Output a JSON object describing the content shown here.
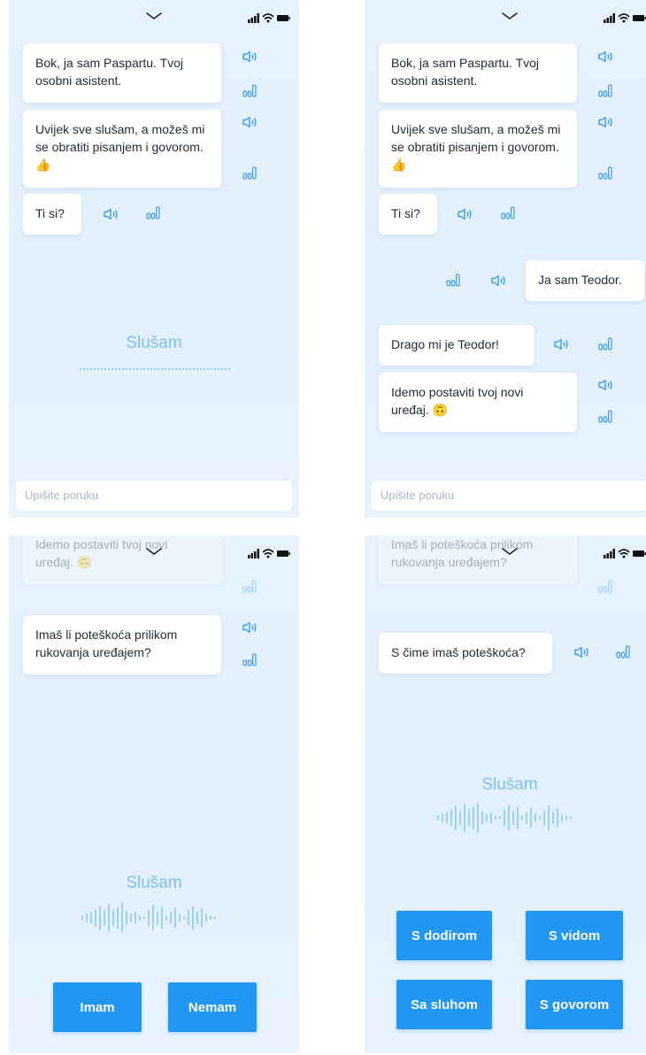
{
  "screen1": {
    "messages": [
      "Bok, ja sam Paspartu. Tvoj osobni asistent.",
      "Uvijek sve slušam, a možeš mi se obratiti pisanjem i govorom.",
      "Ti si?"
    ],
    "listening_label": "Slušam",
    "input_placeholder": "Upišite poruku"
  },
  "screen2": {
    "messages": [
      "Bok, ja sam Paspartu. Tvoj osobni asistent.",
      "Uvijek sve slušam, a možeš mi se obratiti pisanjem i govorom.",
      "Ti si?",
      "Ja sam Teodor.",
      "Drago mi je Teodor!",
      "Idemo postaviti tvoj novi uređaj."
    ],
    "input_placeholder": "Upišite poruku"
  },
  "screen3": {
    "messages": [
      "Idemo postaviti tvoj novi uređaj.",
      "Imaš li poteškoća prilikom rukovanja uređajem?"
    ],
    "listening_label": "Slušam",
    "buttons": [
      "Imam",
      "Nemam"
    ]
  },
  "screen4": {
    "messages": [
      "Imaš li poteškoća prilikom rukovanja uređajem?",
      "S čime imaš poteškoća?"
    ],
    "listening_label": "Slušam",
    "buttons": [
      "S dodirom",
      "S vidom",
      "Sa sluhom",
      "S govorom"
    ]
  },
  "emoji": {
    "thumbs_up": "👍",
    "smile": "🙃"
  },
  "icons": [
    "chevron-down-icon",
    "signal-icon",
    "wifi-icon",
    "battery-icon",
    "speaker-icon",
    "equalizer-icon",
    "waveform-icon"
  ],
  "colors": {
    "accent": "#2196f3",
    "icon_blue": "#3a9be8",
    "listening_text": "#7ec1ee",
    "background": "#e6f2fd"
  }
}
